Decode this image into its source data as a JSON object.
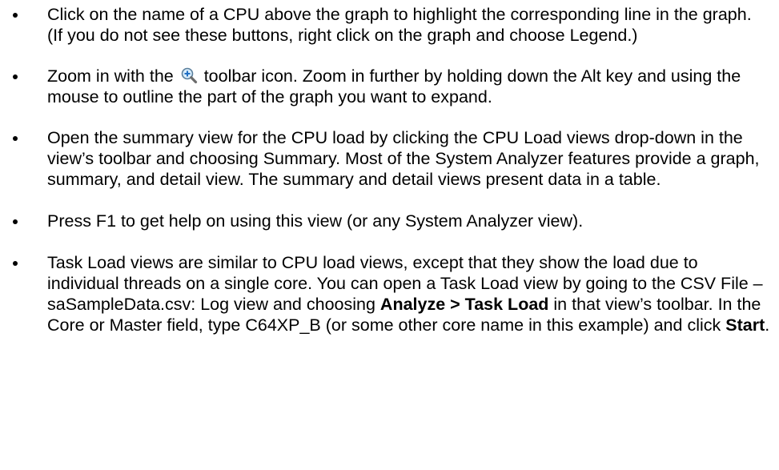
{
  "items": [
    {
      "text": "Click on the name of a CPU above the graph to highlight the corresponding line in the graph. (If you do not see these buttons, right click on the graph and choose Legend.)"
    },
    {
      "text_before": "Zoom in with the",
      "icon": "zoom-in-icon",
      "text_after": "toolbar icon. Zoom in further by holding down the Alt key and using the mouse to outline the part of the graph you want to expand."
    },
    {
      "text": "Open the summary view for the CPU load by clicking the CPU Load views drop-down in the view’s toolbar and choosing Summary. Most of the System Analyzer features provide a graph, summary, and detail view. The summary and detail views present data in a table."
    },
    {
      "text": "Press F1 to get help on using this view (or any System Analyzer view)."
    },
    {
      "text_1": "Task Load views are similar to CPU load views, except that they show the load due to individual threads on a single core. You can open a Task Load view by going to the CSV File – saSampleData.csv: Log view and choosing",
      "bold_1": "Analyze > Task Load",
      "text_2": "in that view’s toolbar. In the Core or Master field, type C64XP_B (or some other core name in this example) and click",
      "bold_2": "Start",
      "text_3": "."
    }
  ]
}
